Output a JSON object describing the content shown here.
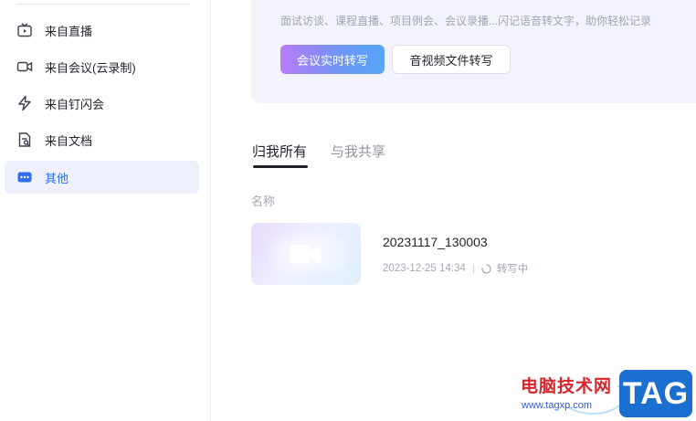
{
  "sidebar": {
    "items": [
      {
        "label": "来自直播",
        "icon": "tv-icon",
        "active": false
      },
      {
        "label": "来自会议(云录制)",
        "icon": "video-camera-icon",
        "active": false
      },
      {
        "label": "来自钉闪会",
        "icon": "flash-meeting-icon",
        "active": false
      },
      {
        "label": "来自文档",
        "icon": "document-icon",
        "active": false
      },
      {
        "label": "其他",
        "icon": "more-dots-icon",
        "active": true
      }
    ]
  },
  "banner": {
    "description": "面试访谈、课程直播、项目例会、会议录播...闪记语音转文字，助你轻松记录",
    "primary_button": "会议实时转写",
    "secondary_button": "音视频文件转写"
  },
  "tabs": [
    {
      "label": "归我所有",
      "active": true
    },
    {
      "label": "与我共享",
      "active": false
    }
  ],
  "list": {
    "column_header": "名称",
    "files": [
      {
        "name": "20231117_130003",
        "date": "2023-12-25 14:34",
        "status": "转写中",
        "thumbnail_icon": "video-camera-icon"
      }
    ]
  },
  "watermark": {
    "text": "电脑技术网",
    "url": "www.tagxp.com",
    "tag": "TAG"
  },
  "colors": {
    "accent": "#2d6ff0",
    "active_bg": "#eef1fb",
    "button_gradient_start": "#b77cf6",
    "button_gradient_end": "#5aa5f8",
    "watermark_red": "#d6262e",
    "watermark_blue": "#1b6fd1"
  }
}
